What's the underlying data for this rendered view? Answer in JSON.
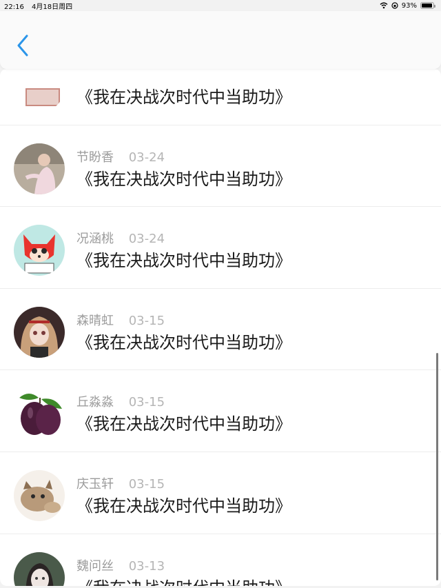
{
  "status": {
    "time": "22:16",
    "date": "4月18日周四",
    "battery": "93%",
    "battery_level": 0.93
  },
  "items": [
    {
      "name": "",
      "date": "",
      "title": "《我在决战次时代中当助功》",
      "avatar": "partial-avatar"
    },
    {
      "name": "节盼香",
      "date": "03-24",
      "title": "《我在决战次时代中当助功》",
      "avatar": "girl-photo"
    },
    {
      "name": "况涵桃",
      "date": "03-24",
      "title": "《我在决战次时代中当助功》",
      "avatar": "red-fox-cartoon"
    },
    {
      "name": "森晴虹",
      "date": "03-15",
      "title": "《我在决战次时代中当助功》",
      "avatar": "anime-girl"
    },
    {
      "name": "丘淼淼",
      "date": "03-15",
      "title": "《我在决战次时代中当助功》",
      "avatar": "plum-fruit"
    },
    {
      "name": "庆玉轩",
      "date": "03-15",
      "title": "《我在决战次时代中当助功》",
      "avatar": "cat-photo"
    },
    {
      "name": "魏问丝",
      "date": "03-13",
      "title": "《我在决战次时代中当助功》",
      "avatar": "woman-photo"
    }
  ]
}
